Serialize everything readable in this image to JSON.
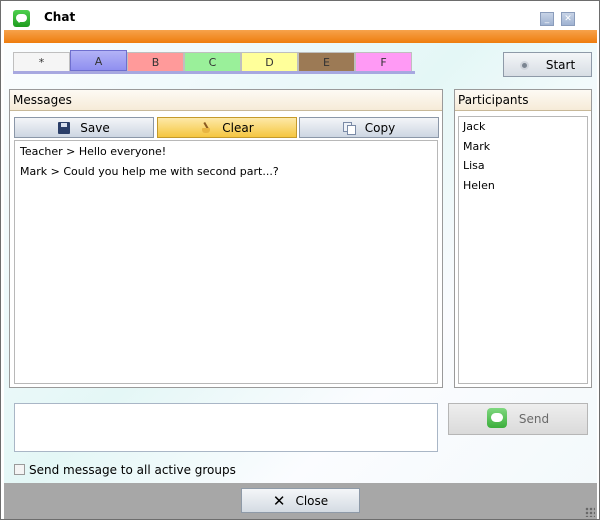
{
  "window": {
    "title": "Chat",
    "accent_color": "#ee7d0e"
  },
  "title_buttons": {
    "minimize_icon": "minimize-icon",
    "close_icon": "close-icon"
  },
  "tabs": [
    {
      "label": "*",
      "color": "#f5f5f5",
      "selected": false
    },
    {
      "label": "A",
      "color": "#8f8ff0",
      "selected": true
    },
    {
      "label": "B",
      "color": "#ff9a9a",
      "selected": false
    },
    {
      "label": "C",
      "color": "#9af09a",
      "selected": false
    },
    {
      "label": "D",
      "color": "#ffff9a",
      "selected": false
    },
    {
      "label": "E",
      "color": "#9c7a55",
      "selected": false
    },
    {
      "label": "F",
      "color": "#ff9af5",
      "selected": false
    }
  ],
  "start_button": {
    "label": "Start",
    "icon": "record-icon"
  },
  "messages": {
    "header": "Messages",
    "save_label": "Save",
    "clear_label": "Clear",
    "copy_label": "Copy",
    "lines": [
      "Teacher > Hello everyone!",
      "Mark > Could you help me with second part...?"
    ]
  },
  "participants": {
    "header": "Participants",
    "items": [
      "Jack",
      "Mark",
      "Lisa",
      "Helen"
    ]
  },
  "compose": {
    "value": "",
    "send_label": "Send",
    "all_groups_label": "Send message to all active groups",
    "all_groups_checked": false
  },
  "footer": {
    "close_label": "Close"
  }
}
